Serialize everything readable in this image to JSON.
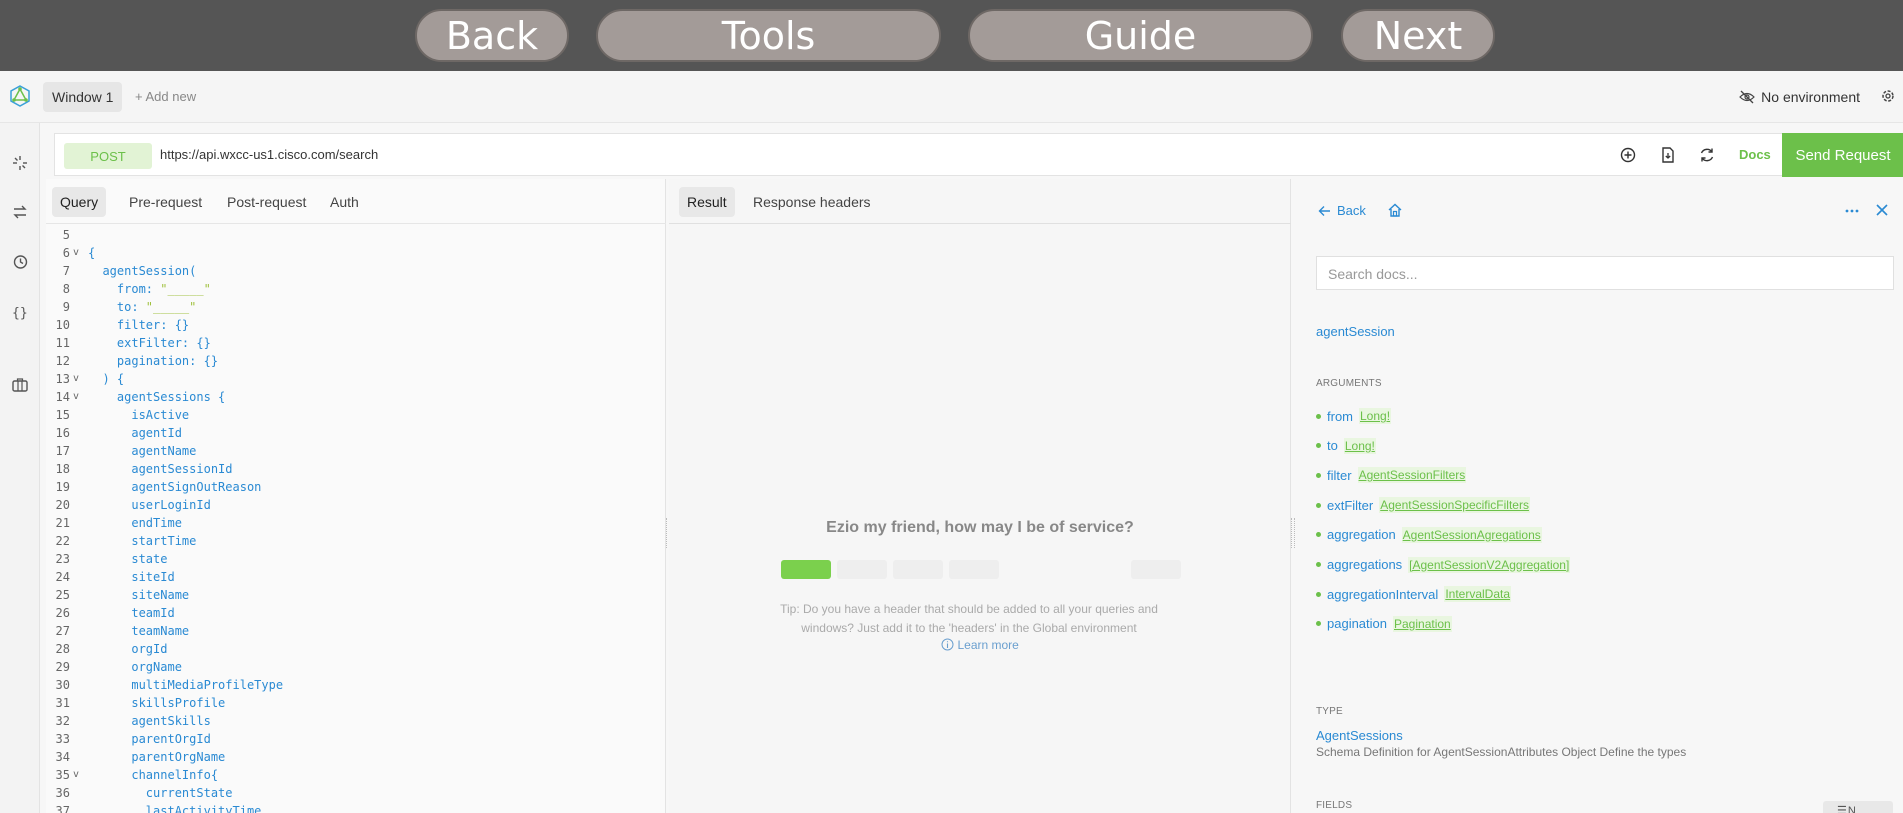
{
  "topnav": {
    "back": "Back",
    "tools": "Tools",
    "guide": "Guide",
    "next": "Next"
  },
  "tabbar": {
    "window_tab": "Window 1",
    "add_new": "+ Add new",
    "environment": "No environment"
  },
  "request": {
    "method": "POST",
    "url": "https://api.wxcc-us1.cisco.com/search",
    "docs_label": "Docs",
    "send_label": "Send Request"
  },
  "query_tabs": [
    "Query",
    "Pre-request",
    "Post-request",
    "Auth"
  ],
  "code_lines": [
    {
      "n": "5",
      "text": "",
      "fold": ""
    },
    {
      "n": "6",
      "text": "{",
      "fold": "v"
    },
    {
      "n": "7",
      "text": "  agentSession(",
      "fold": ""
    },
    {
      "n": "8",
      "text": "    from: ",
      "str": "\"_____\"",
      "fold": ""
    },
    {
      "n": "9",
      "text": "    to: ",
      "str": "\"_____\"",
      "fold": ""
    },
    {
      "n": "10",
      "text": "    filter: {}",
      "fold": ""
    },
    {
      "n": "11",
      "text": "    extFilter: {}",
      "fold": ""
    },
    {
      "n": "12",
      "text": "    pagination: {}",
      "fold": ""
    },
    {
      "n": "13",
      "text": "  ) {",
      "fold": "v"
    },
    {
      "n": "14",
      "text": "    agentSessions {",
      "fold": "v"
    },
    {
      "n": "15",
      "text": "      isActive",
      "fold": ""
    },
    {
      "n": "16",
      "text": "      agentId",
      "fold": ""
    },
    {
      "n": "17",
      "text": "      agentName",
      "fold": ""
    },
    {
      "n": "18",
      "text": "      agentSessionId",
      "fold": ""
    },
    {
      "n": "19",
      "text": "      agentSignOutReason",
      "fold": ""
    },
    {
      "n": "20",
      "text": "      userLoginId",
      "fold": ""
    },
    {
      "n": "21",
      "text": "      endTime",
      "fold": ""
    },
    {
      "n": "22",
      "text": "      startTime",
      "fold": ""
    },
    {
      "n": "23",
      "text": "      state",
      "fold": ""
    },
    {
      "n": "24",
      "text": "      siteId",
      "fold": ""
    },
    {
      "n": "25",
      "text": "      siteName",
      "fold": ""
    },
    {
      "n": "26",
      "text": "      teamId",
      "fold": ""
    },
    {
      "n": "27",
      "text": "      teamName",
      "fold": ""
    },
    {
      "n": "28",
      "text": "      orgId",
      "fold": ""
    },
    {
      "n": "29",
      "text": "      orgName",
      "fold": ""
    },
    {
      "n": "30",
      "text": "      multiMediaProfileType",
      "fold": ""
    },
    {
      "n": "31",
      "text": "      skillsProfile",
      "fold": ""
    },
    {
      "n": "32",
      "text": "      agentSkills",
      "fold": ""
    },
    {
      "n": "33",
      "text": "      parentOrgId",
      "fold": ""
    },
    {
      "n": "34",
      "text": "      parentOrgName",
      "fold": ""
    },
    {
      "n": "35",
      "text": "      channelInfo{",
      "fold": "v"
    },
    {
      "n": "36",
      "text": "        currentState",
      "fold": ""
    },
    {
      "n": "37",
      "text": "        lastActivityTime",
      "fold": ""
    }
  ],
  "result": {
    "tabs": [
      "Result",
      "Response headers"
    ],
    "greeting": "Ezio my friend, how may I be of service?",
    "tip": "Tip: Do you have a header that should be added to all your queries and windows? Just add it to the 'headers' in the Global environment",
    "learn_more": "Learn more"
  },
  "docs": {
    "back": "Back",
    "search_placeholder": "Search docs...",
    "title": "agentSession",
    "arguments_label": "ARGUMENTS",
    "arguments": [
      {
        "name": "from",
        "type": "Long!"
      },
      {
        "name": "to",
        "type": "Long!"
      },
      {
        "name": "filter",
        "type": "AgentSessionFilters"
      },
      {
        "name": "extFilter",
        "type": "AgentSessionSpecificFilters"
      },
      {
        "name": "aggregation",
        "type": "AgentSessionAgregations"
      },
      {
        "name": "aggregations",
        "type": "[AgentSessionV2Aggregation]"
      },
      {
        "name": "aggregationInterval",
        "type": "IntervalData"
      },
      {
        "name": "pagination",
        "type": "Pagination"
      }
    ],
    "type_label": "TYPE",
    "type_name": "AgentSessions",
    "type_desc": "Schema Definition for AgentSessionAttributes Object Define the types",
    "fields_label": "FIELDS",
    "fields_btn": "N"
  },
  "colors": {
    "accent_green": "#6cc04a",
    "link_blue": "#2a8ad3",
    "nav_bg": "#555555",
    "nav_button": "#a39b98"
  },
  "icons": [
    "app-logo-icon",
    "eye-slash-icon",
    "gear-icon",
    "loader-icon",
    "swap-icon",
    "history-icon",
    "braces-icon",
    "briefcase-icon",
    "add-circle-icon",
    "save-file-icon",
    "refresh-icon",
    "arrow-left-icon",
    "home-icon",
    "more-icon",
    "close-icon",
    "info-icon"
  ]
}
